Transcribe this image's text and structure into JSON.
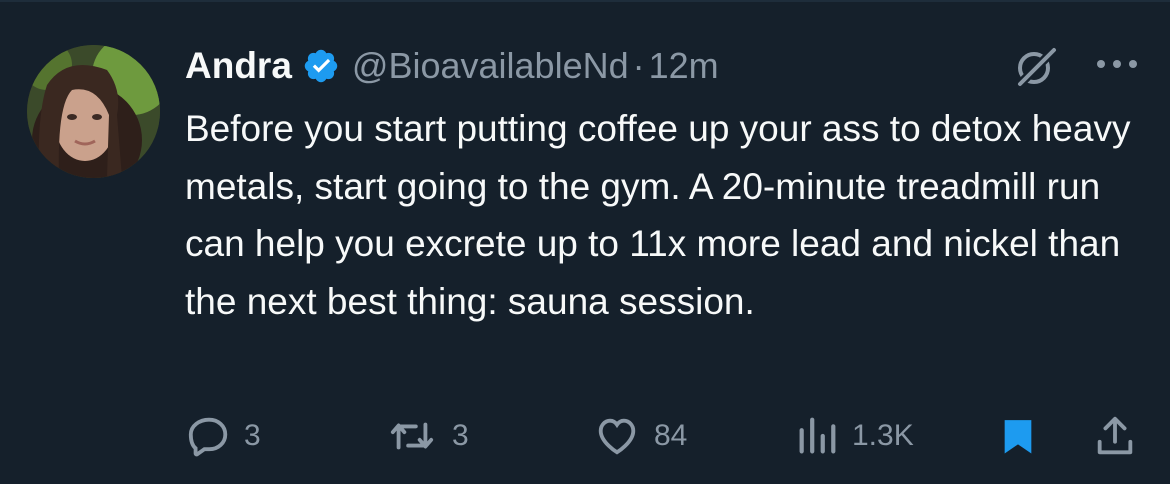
{
  "author": {
    "name": "Andra",
    "handle": "@BioavailableNd",
    "separator": "·",
    "time": "12m",
    "verified": true
  },
  "tweet": {
    "text": "Before you start putting coffee up your ass to detox heavy metals, start going to the gym. A 20-minute treadmill run can help you excrete up to 11x more lead and nickel than the next best thing: sauna session."
  },
  "actions": {
    "replies": "3",
    "reposts": "3",
    "likes": "84",
    "views": "1.3K",
    "bookmarked": true
  },
  "icons": [
    "grok-icon",
    "more-icon",
    "reply-icon",
    "repost-icon",
    "like-icon",
    "views-icon",
    "bookmark-icon",
    "share-icon",
    "verified-badge-icon"
  ],
  "colors": {
    "background": "#15202b",
    "text": "#f7f9f9",
    "muted": "#8b98a5",
    "accent": "#1d9bf0"
  }
}
